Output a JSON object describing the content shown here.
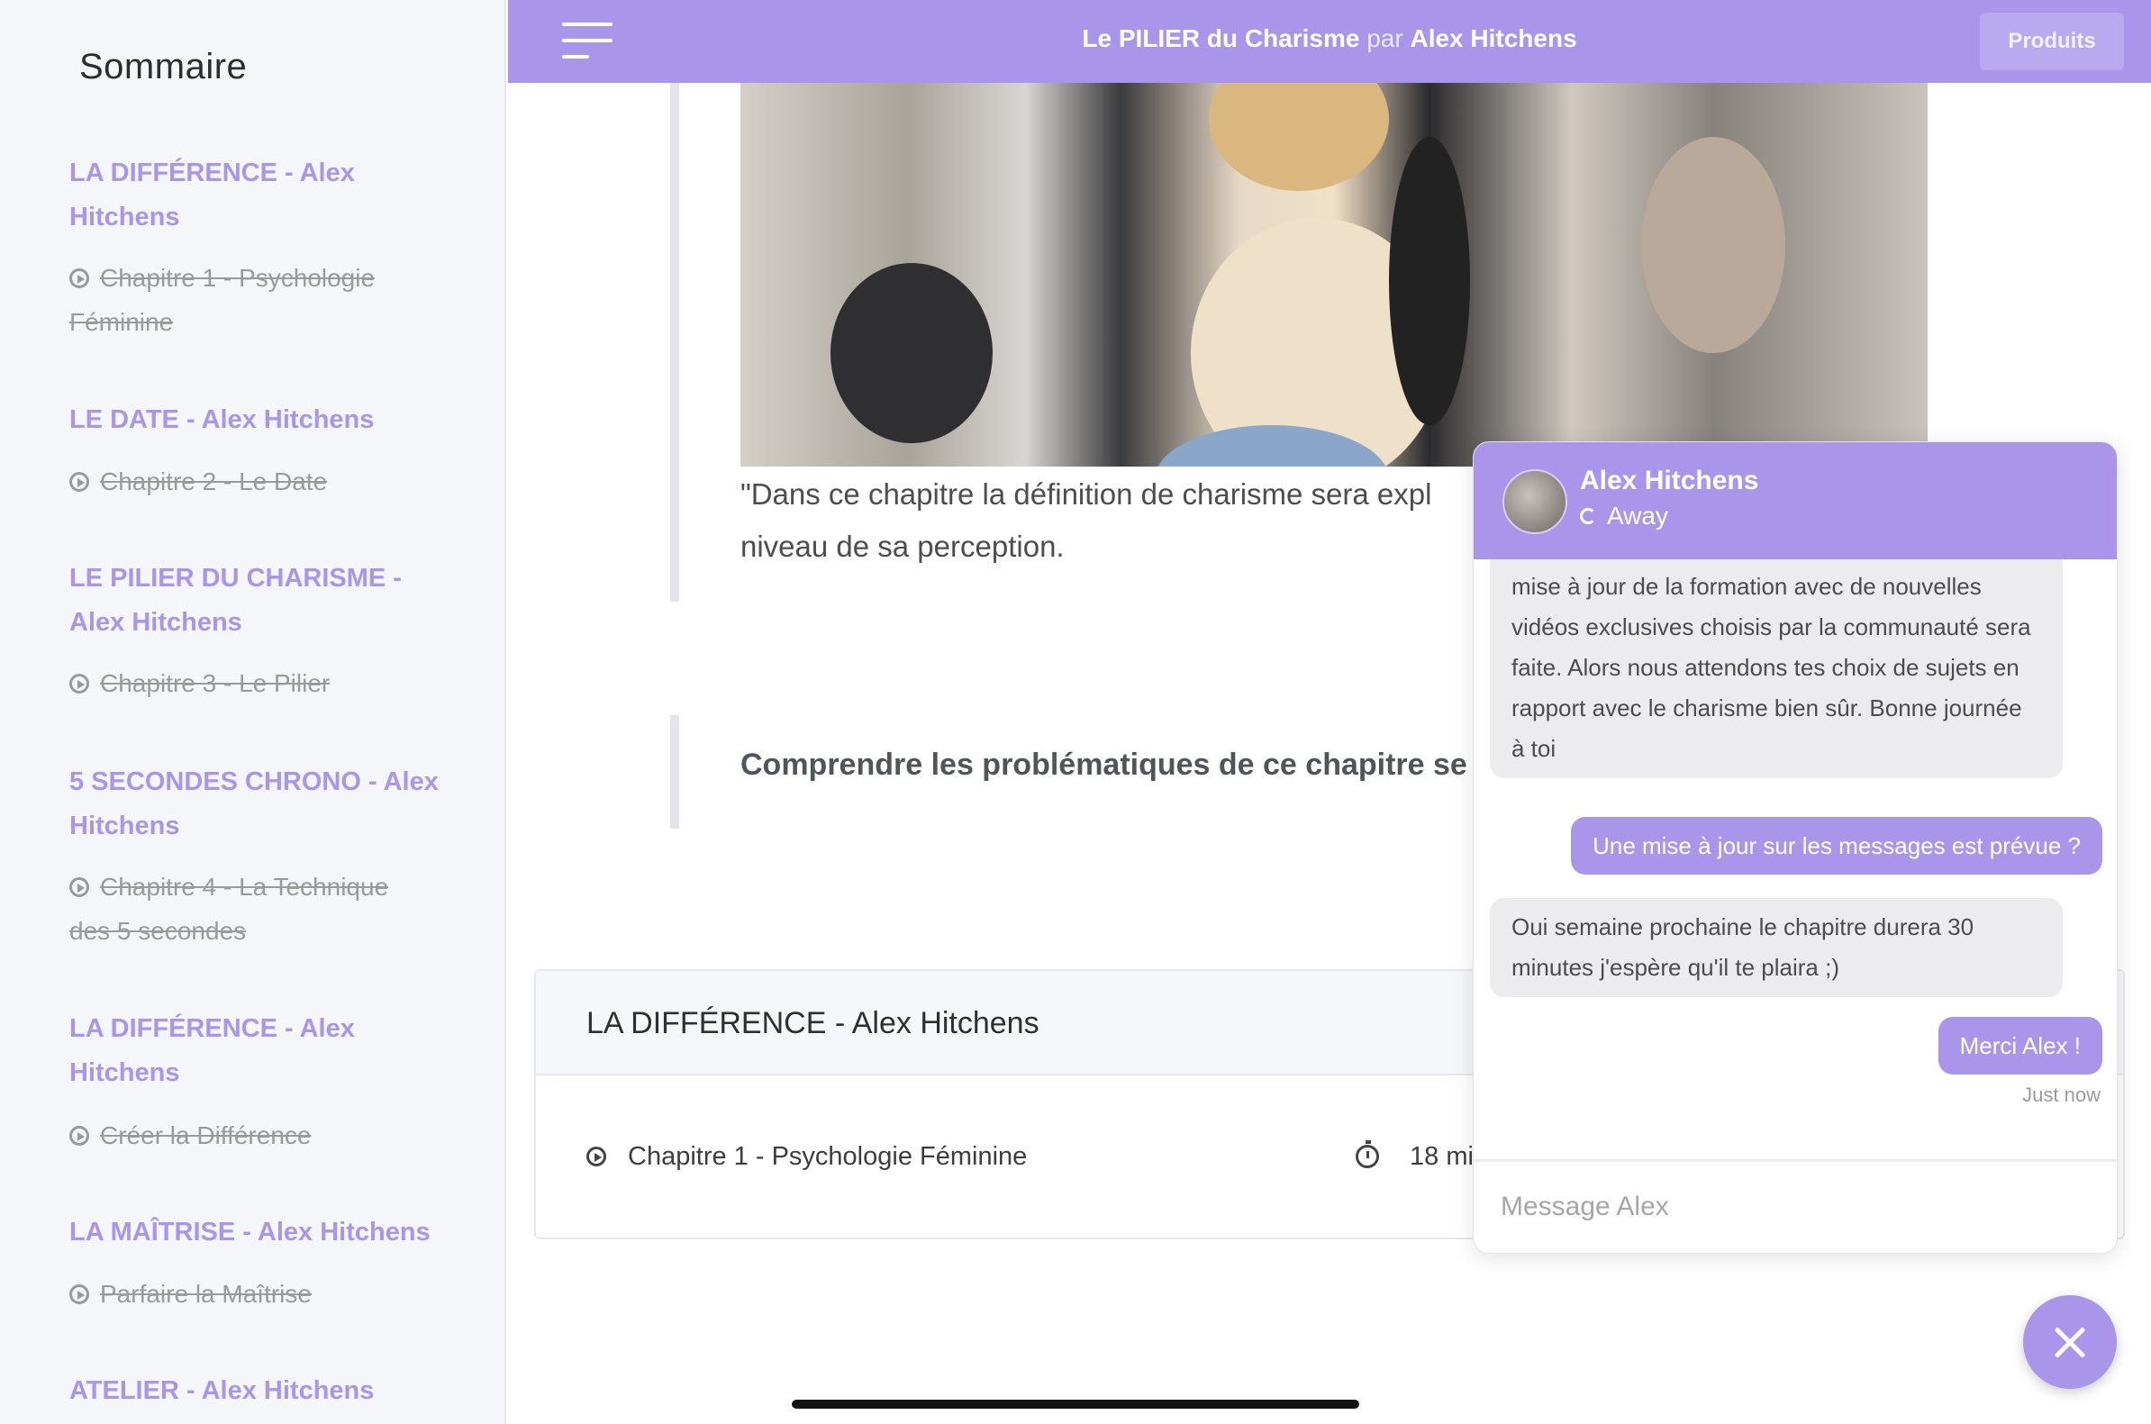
{
  "sidebar": {
    "title": "Sommaire",
    "sections": [
      {
        "title": "LA DIFFÉRENCE - Alex Hitchens",
        "chapter": "Chapitre 1 - Psychologie Féminine"
      },
      {
        "title": "LE DATE - Alex Hitchens",
        "chapter": "Chapitre 2 - Le Date"
      },
      {
        "title": "LE PILIER DU CHARISME - Alex Hitchens",
        "chapter": "Chapitre 3 - Le Pilier"
      },
      {
        "title": "5 SECONDES CHRONO - Alex Hitchens",
        "chapter": "Chapitre 4 - La Technique des 5 secondes"
      },
      {
        "title": "LA DIFFÉRENCE - Alex Hitchens",
        "chapter": "Créer la Différence"
      },
      {
        "title": "LA MAÎTRISE - Alex Hitchens",
        "chapter": "Parfaire la Maîtrise"
      },
      {
        "title": "ATELIER - Alex Hitchens"
      }
    ]
  },
  "header": {
    "course_title": "Le PILIER du Charisme",
    "by": "par",
    "author": "Alex Hitchens",
    "products_label": "Produits"
  },
  "main": {
    "quote_line1": "\"Dans ce chapitre la définition de charisme sera expl",
    "quote_line2": "niveau de sa perception.",
    "problem_heading": "Comprendre les problématiques de ce chapitre se",
    "card": {
      "title": "LA DIFFÉRENCE - Alex Hitchens",
      "chapter": "Chapitre 1 - Psychologie Féminine",
      "duration": "18 mi"
    }
  },
  "chat": {
    "agent_name": "Alex Hitchens",
    "status": "Away",
    "messages": [
      {
        "from": "agent",
        "text": "mise à jour de la formation avec de nouvelles vidéos exclusives choisis par la communauté sera faite. Alors nous attendons tes choix de sujets en rapport avec le charisme bien sûr. Bonne journée à toi"
      },
      {
        "from": "user",
        "text": "Une mise à jour sur les messages est prévue ?"
      },
      {
        "from": "agent",
        "text": "Oui semaine prochaine le chapitre durera 30 minutes j'espère qu'il te plaira ;)"
      },
      {
        "from": "user",
        "text": "Merci Alex !"
      }
    ],
    "timestamp": "Just now",
    "composer_placeholder": "Message Alex"
  },
  "colors": {
    "accent": "#a995e9",
    "sidebar_bg": "#f5f6f9",
    "bubble_in": "#ececee"
  },
  "icons": [
    "menu-icon",
    "play-icon",
    "timer-icon",
    "status-away-icon",
    "close-icon"
  ]
}
